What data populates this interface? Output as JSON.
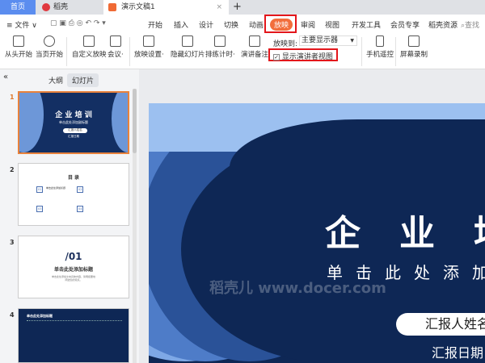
{
  "tabs": {
    "home": "首页",
    "docer": "稻壳",
    "doc": "演示文稿1",
    "new": "+",
    "close": "×"
  },
  "menu": {
    "file": "≡ 文件 ∨",
    "items": [
      "开始",
      "插入",
      "设计",
      "切换",
      "动画",
      "放映",
      "审阅",
      "视图",
      "开发工具",
      "会员专享",
      "稻壳资源"
    ],
    "search": "查找"
  },
  "ribbon": {
    "from_start": "从头开始",
    "from_current": "当页开始",
    "custom": "自定义放映",
    "meeting": "会议·",
    "settings": "放映设置·",
    "hide": "隐藏幻灯片",
    "rehearse": "排练计时·",
    "notes": "演讲备注",
    "play_to_label": "放映到:",
    "play_to_value": "主要显示器",
    "presenter_view": "显示演讲者视图",
    "presenter_checked": true,
    "phone": "手机遥控",
    "record": "屏幕录制"
  },
  "panel": {
    "collapse": "«",
    "outline": "大纲",
    "slides": "幻灯片",
    "numbers": [
      "1",
      "2",
      "3",
      "4"
    ],
    "thumb1": {
      "title": "企 业 培 训",
      "sub": "单击此处添加副标题",
      "name": "汇报人姓名",
      "date": "汇报日期"
    },
    "thumb2": {
      "title": "目 录",
      "items": [
        "01",
        "02",
        "03",
        "04"
      ],
      "item_title": "单击此处添加标题"
    },
    "thumb3": {
      "num": "/01",
      "title": "单击此处添加标题",
      "body": "单击此处添加文本具体内容，简明扼要地阐述您的观点。"
    },
    "thumb4": {
      "title": "单击此处添加标题"
    }
  },
  "slide": {
    "title": "企业培训",
    "subtitle": "单击此处添加副标题",
    "reporter": "汇报人姓名",
    "date": "汇报日期",
    "watermark": "稻壳儿 www.docer.com"
  },
  "colors": {
    "accent": "#f26e3c",
    "navy": "#0e2755",
    "home_tab": "#5b8def",
    "highlight": "#e3161b"
  }
}
